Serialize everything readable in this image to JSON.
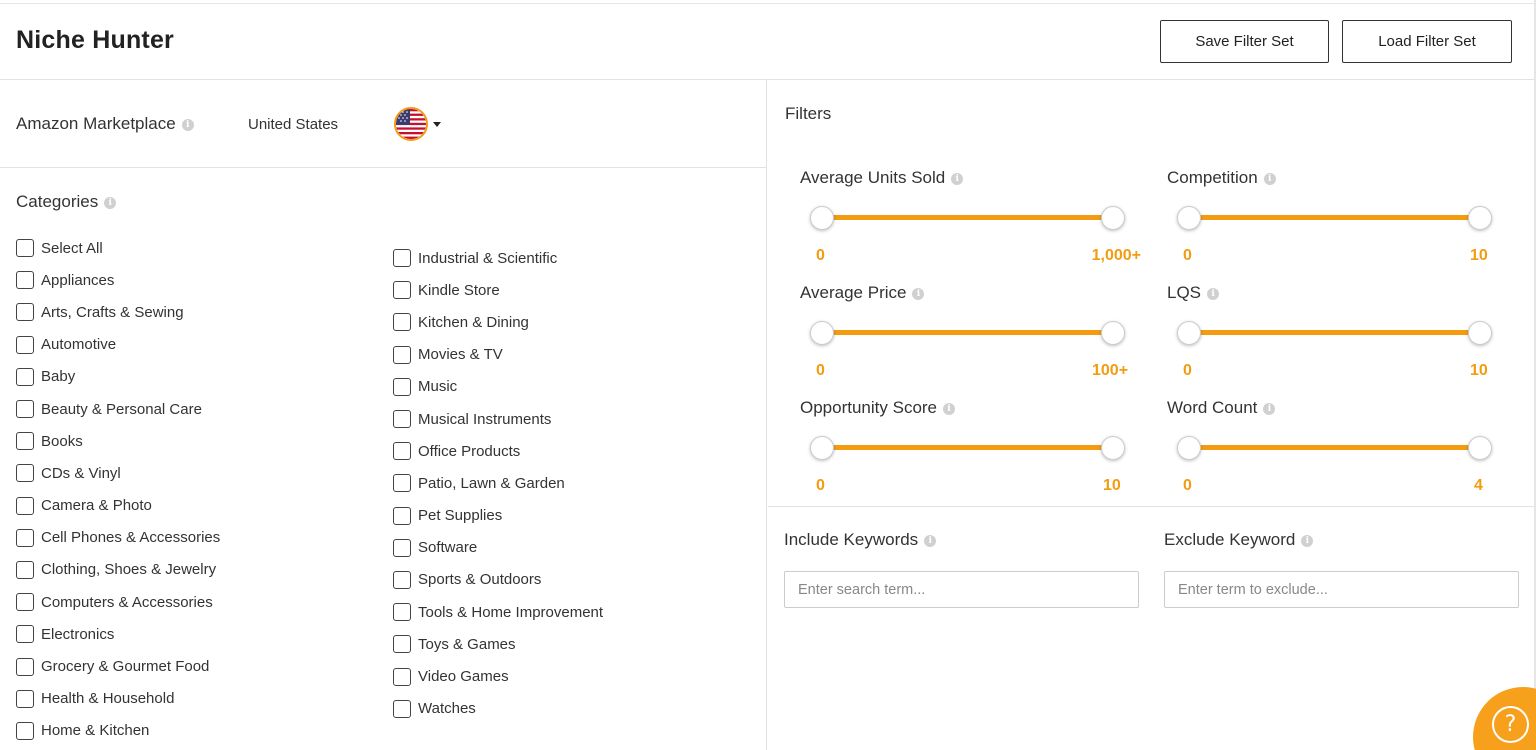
{
  "app": {
    "title": "Niche Hunter",
    "save_filter_label": "Save Filter Set",
    "load_filter_label": "Load Filter Set"
  },
  "marketplace": {
    "label": "Amazon Marketplace",
    "value": "United States",
    "flag_icon": "us-flag-icon"
  },
  "categories": {
    "title": "Categories",
    "column1": [
      "Select All",
      "Appliances",
      "Arts, Crafts & Sewing",
      "Automotive",
      "Baby",
      "Beauty & Personal Care",
      "Books",
      "CDs & Vinyl",
      "Camera & Photo",
      "Cell Phones & Accessories",
      "Clothing, Shoes & Jewelry",
      "Computers & Accessories",
      "Electronics",
      "Grocery & Gourmet Food",
      "Health & Household",
      "Home & Kitchen"
    ],
    "column2": [
      "Industrial & Scientific",
      "Kindle Store",
      "Kitchen & Dining",
      "Movies & TV",
      "Music",
      "Musical Instruments",
      "Office Products",
      "Patio, Lawn & Garden",
      "Pet Supplies",
      "Software",
      "Sports & Outdoors",
      "Tools & Home Improvement",
      "Toys & Games",
      "Video Games",
      "Watches"
    ]
  },
  "filters": {
    "title": "Filters",
    "sliders": [
      {
        "label": "Average Units Sold",
        "min": "0",
        "max": "1,000+"
      },
      {
        "label": "Competition",
        "min": "0",
        "max": "10"
      },
      {
        "label": "Average Price",
        "min": "0",
        "max": "100+"
      },
      {
        "label": "LQS",
        "min": "0",
        "max": "10"
      },
      {
        "label": "Opportunity Score",
        "min": "0",
        "max": "10"
      },
      {
        "label": "Word Count",
        "min": "0",
        "max": "4"
      }
    ]
  },
  "keywords": {
    "include_label": "Include Keywords",
    "include_placeholder": "Enter search term...",
    "exclude_label": "Exclude Keyword",
    "exclude_placeholder": "Enter term to exclude..."
  },
  "help": {
    "glyph": "?"
  },
  "colors": {
    "accent": "#f39c12",
    "help_bg": "#f7a01c",
    "border": "#e2e2e2"
  }
}
